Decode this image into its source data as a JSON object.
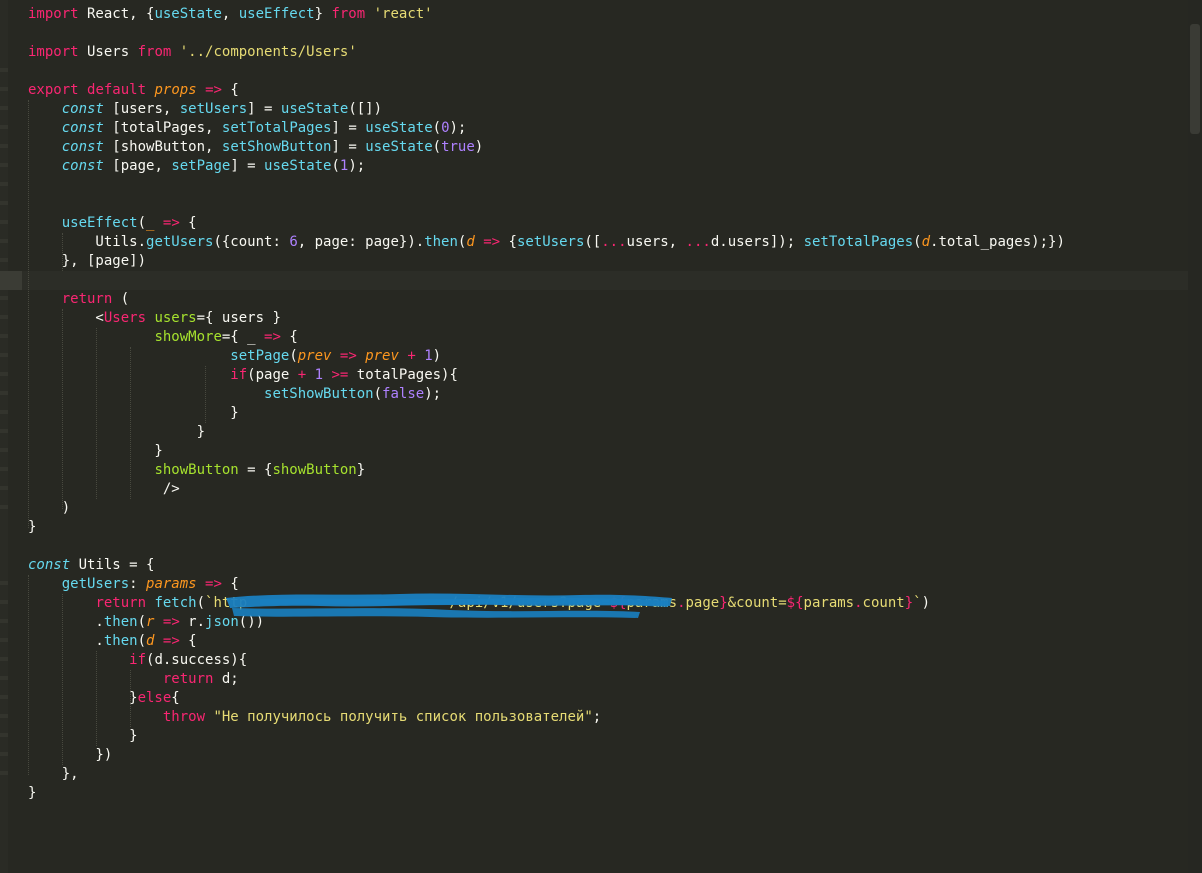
{
  "editor": {
    "language": "javascript",
    "theme_colors": {
      "background": "#272822",
      "keyword": "#f92672",
      "string": "#e6db74",
      "number": "#ae81ff",
      "function": "#66d9ef",
      "parameter": "#fd971f",
      "attribute": "#a6e22e",
      "text": "#f8f8f2",
      "redaction": "#1a7fc1"
    },
    "lines": [
      "import React, {useState, useEffect} from 'react'",
      "",
      "import Users from '../components/Users'",
      "",
      "export default props => {",
      "    const [users, setUsers] = useState([])",
      "    const [totalPages, setTotalPages] = useState(0);",
      "    const [showButton, setShowButton] = useState(true)",
      "    const [page, setPage] = useState(1);",
      "",
      "",
      "    useEffect(_ => {",
      "        Utils.getUsers({count: 6, page: page}).then(d => {setUsers([...users, ...d.users]); setTotalPages(d.total_pages);})",
      "    }, [page])",
      "",
      "    return (",
      "        <Users users={ users }",
      "               showMore={ _ => {",
      "                        setPage(prev => prev + 1)",
      "                        if(page + 1 >= totalPages){",
      "                            setShowButton(false);",
      "                        }",
      "                    }",
      "               }",
      "               showButton = {showButton}",
      "                />",
      "    )",
      "}",
      "",
      "const Utils = {",
      "    getUsers: params => {",
      "        return fetch(`http                        /api/v1/users?page=${params.page}&count=${params.count}`)",
      "        .then(r => r.json())",
      "        .then(d => {",
      "            if(d.success){",
      "                return d;",
      "            }else{",
      "                throw \"Не получилось получить список пользователей\";",
      "            }",
      "        })",
      "    },",
      "}"
    ]
  }
}
